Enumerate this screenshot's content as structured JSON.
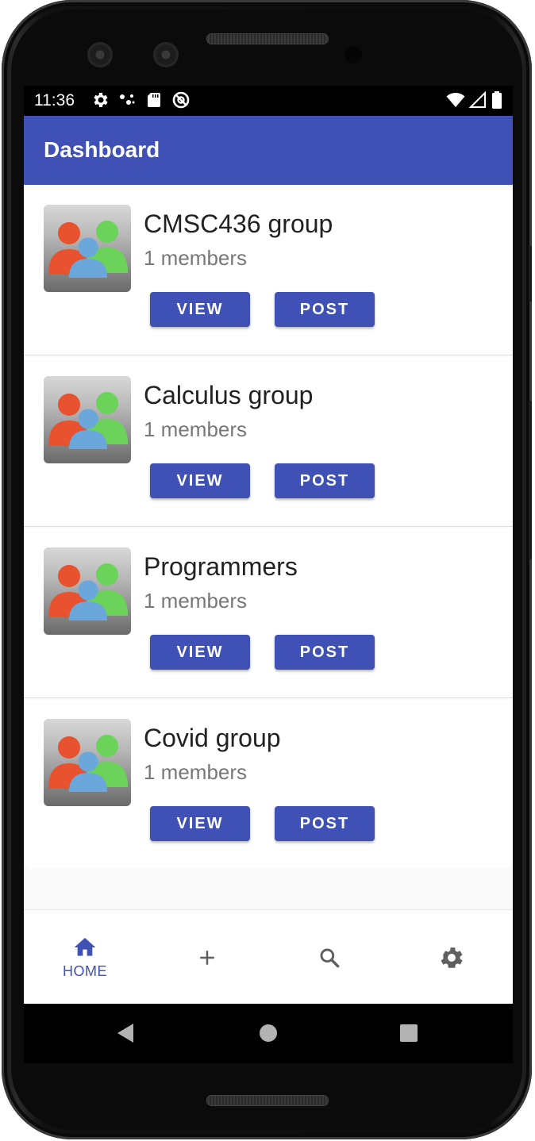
{
  "status_bar": {
    "time": "11:36",
    "left_icons": [
      "gear-icon",
      "dots-icon",
      "sd-card-icon",
      "no-disturb-icon"
    ],
    "right_icons": [
      "wifi-icon",
      "signal-icon",
      "battery-icon"
    ]
  },
  "app_bar": {
    "title": "Dashboard"
  },
  "groups": [
    {
      "name": "CMSC436 group",
      "members": "1 members",
      "view_label": "VIEW",
      "post_label": "POST"
    },
    {
      "name": "Calculus group",
      "members": "1 members",
      "view_label": "VIEW",
      "post_label": "POST"
    },
    {
      "name": "Programmers",
      "members": "1 members",
      "view_label": "VIEW",
      "post_label": "POST"
    },
    {
      "name": "Covid group",
      "members": "1 members",
      "view_label": "VIEW",
      "post_label": "POST"
    }
  ],
  "bottom_nav": {
    "items": [
      {
        "icon": "home-icon",
        "label": "HOME",
        "active": true
      },
      {
        "icon": "plus-icon",
        "label": "",
        "active": false
      },
      {
        "icon": "search-icon",
        "label": "",
        "active": false
      },
      {
        "icon": "gear-icon",
        "label": "",
        "active": false
      }
    ]
  },
  "colors": {
    "primary": "#3f51b5",
    "icon_inactive": "#5f5f5f",
    "person_left": "#e8522f",
    "person_right": "#6bd25a",
    "person_center": "#6aa8dc"
  }
}
